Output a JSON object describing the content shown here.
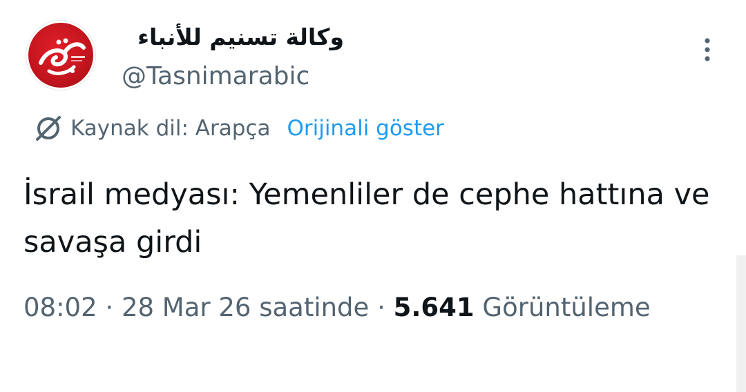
{
  "author": {
    "display_name": "وكالة تسنيم للأنباء",
    "handle": "@Tasnimarabic",
    "avatar_logo_text": "تسنيم",
    "avatar_color": "#c8141d"
  },
  "more_icon": "more-vertical-icon",
  "translation": {
    "icon": "translate-icon",
    "source_label": "Kaynak dil: Arapça",
    "show_original": "Orijinali göster"
  },
  "tweet": {
    "text": "İsrail medyası: Yemenliler de cephe hattına ve savaşa girdi"
  },
  "meta": {
    "time": "08:02",
    "sep1": " · ",
    "date": "28 Mar 26 saatinde",
    "sep2": " · ",
    "views_count": "5.641",
    "views_label": "Görüntüleme"
  },
  "colors": {
    "link": "#1d9bf0",
    "secondary_text": "#536471",
    "primary_text": "#0f1419"
  }
}
